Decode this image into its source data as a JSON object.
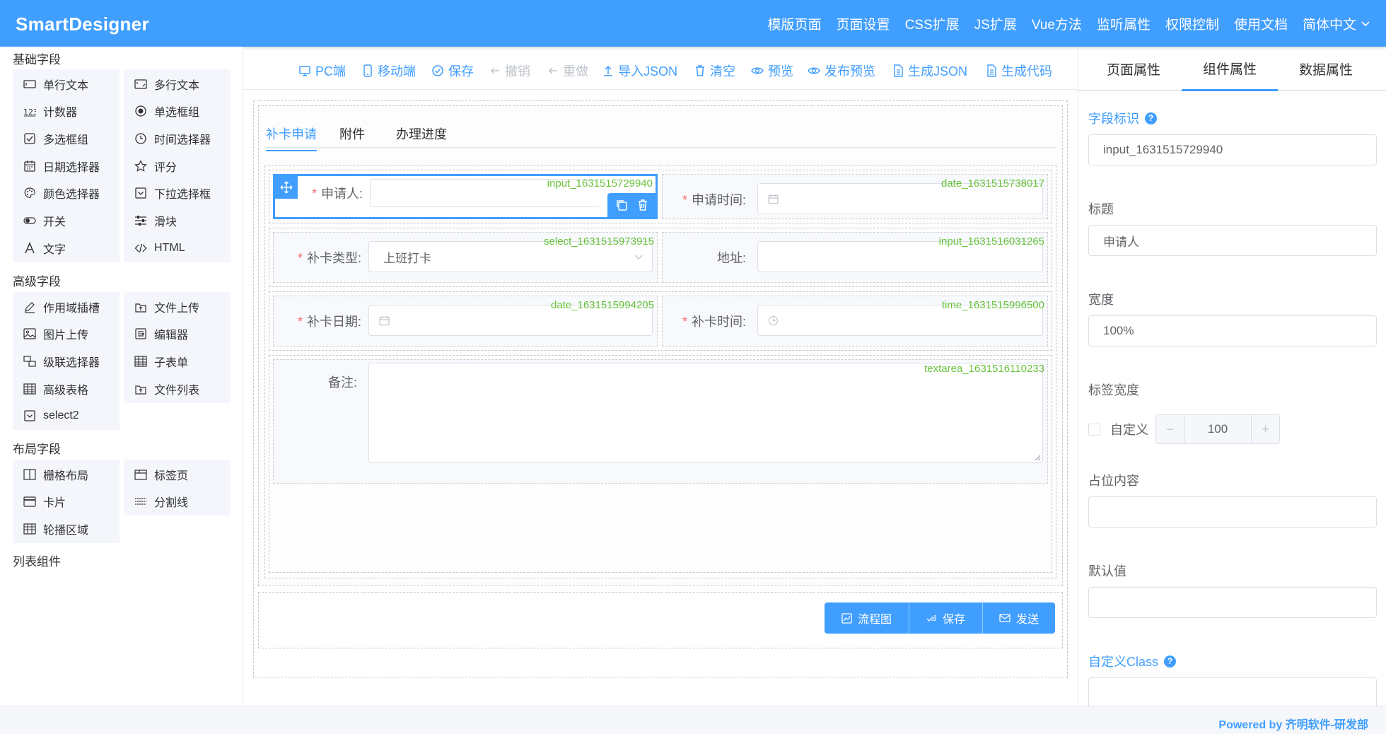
{
  "app": {
    "logo": "SmartDesigner"
  },
  "topnav": {
    "items": [
      "模版页面",
      "页面设置",
      "CSS扩展",
      "JS扩展",
      "Vue方法",
      "监听属性",
      "权限控制",
      "使用文档"
    ],
    "lang": "简体中文"
  },
  "left": {
    "groups": [
      {
        "title": "基础字段",
        "items": [
          {
            "label": "单行文本",
            "icon": "input-icon"
          },
          {
            "label": "多行文本",
            "icon": "textarea-icon"
          },
          {
            "label": "计数器",
            "icon": "number-icon"
          },
          {
            "label": "单选框组",
            "icon": "radio-icon"
          },
          {
            "label": "多选框组",
            "icon": "checkbox-icon"
          },
          {
            "label": "时间选择器",
            "icon": "clock-icon"
          },
          {
            "label": "日期选择器",
            "icon": "calendar-icon"
          },
          {
            "label": "评分",
            "icon": "star-icon"
          },
          {
            "label": "颜色选择器",
            "icon": "palette-icon"
          },
          {
            "label": "下拉选择框",
            "icon": "select-icon"
          },
          {
            "label": "开关",
            "icon": "switch-icon"
          },
          {
            "label": "滑块",
            "icon": "slider-icon"
          },
          {
            "label": "文字",
            "icon": "text-icon"
          },
          {
            "label": "HTML",
            "icon": "code-icon"
          }
        ]
      },
      {
        "title": "高级字段",
        "items": [
          {
            "label": "作用域插槽",
            "icon": "edit-icon"
          },
          {
            "label": "文件上传",
            "icon": "upload-icon"
          },
          {
            "label": "图片上传",
            "icon": "image-icon"
          },
          {
            "label": "编辑器",
            "icon": "editor-icon"
          },
          {
            "label": "级联选择器",
            "icon": "cascader-icon"
          },
          {
            "label": "子表单",
            "icon": "table-icon"
          },
          {
            "label": "高级表格",
            "icon": "table-icon"
          },
          {
            "label": "文件列表",
            "icon": "upload-icon"
          },
          {
            "label": "select2",
            "icon": "select-icon"
          }
        ]
      },
      {
        "title": "布局字段",
        "items": [
          {
            "label": "栅格布局",
            "icon": "grid-icon"
          },
          {
            "label": "标签页",
            "icon": "tabs-icon"
          },
          {
            "label": "卡片",
            "icon": "card-icon"
          },
          {
            "label": "分割线",
            "icon": "divider-icon"
          },
          {
            "label": "轮播区域",
            "icon": "carousel-icon"
          }
        ]
      },
      {
        "title": "列表组件",
        "items": []
      }
    ]
  },
  "toolbar": {
    "items": [
      {
        "label": "PC端",
        "icon": "monitor-icon",
        "disabled": false
      },
      {
        "label": "移动端",
        "icon": "mobile-icon",
        "disabled": false
      },
      {
        "label": "保存",
        "icon": "check-circle-icon",
        "disabled": false
      },
      {
        "label": "撤销",
        "icon": "undo-icon",
        "disabled": true
      },
      {
        "label": "重做",
        "icon": "redo-icon",
        "disabled": true
      },
      {
        "label": "导入JSON",
        "icon": "upload-arrow-icon",
        "disabled": false
      },
      {
        "label": "清空",
        "icon": "trash-icon",
        "disabled": false
      },
      {
        "label": "预览",
        "icon": "eye-icon",
        "disabled": false
      },
      {
        "label": "发布预览",
        "icon": "eye-icon",
        "disabled": false
      },
      {
        "label": "生成JSON",
        "icon": "document-icon",
        "disabled": false
      },
      {
        "label": "生成代码",
        "icon": "document-icon",
        "disabled": false
      }
    ]
  },
  "form": {
    "tabs": [
      "补卡申请",
      "附件",
      "办理进度"
    ],
    "active_tab": "补卡申请",
    "fields": {
      "applicant": {
        "label": "申请人:",
        "required": true,
        "id": "input_1631515729940",
        "value": ""
      },
      "apply_time": {
        "label": "申请时间:",
        "required": true,
        "id": "date_1631515738017",
        "value": ""
      },
      "card_type": {
        "label": "补卡类型:",
        "required": true,
        "id": "select_1631515973915",
        "value": "上班打卡"
      },
      "address": {
        "label": "地址:",
        "required": false,
        "id": "input_1631516031265",
        "value": ""
      },
      "card_date": {
        "label": "补卡日期:",
        "required": true,
        "id": "date_1631515994205",
        "value": ""
      },
      "card_time": {
        "label": "补卡时间:",
        "required": true,
        "id": "time_1631515996500",
        "value": ""
      },
      "remark": {
        "label": "备注:",
        "required": false,
        "id": "textarea_1631516110233",
        "value": ""
      }
    },
    "buttons": [
      {
        "label": "流程图",
        "icon": "flowchart-icon"
      },
      {
        "label": "保存",
        "icon": "save-icon"
      },
      {
        "label": "发送",
        "icon": "mail-icon"
      }
    ]
  },
  "right": {
    "tabs": [
      "页面属性",
      "组件属性",
      "数据属性"
    ],
    "active_tab": "组件属性",
    "props": {
      "field_id_label": "字段标识",
      "field_id_value": "input_1631515729940",
      "title_label": "标题",
      "title_value": "申请人",
      "width_label": "宽度",
      "width_value": "100%",
      "label_width_label": "标签宽度",
      "custom_label": "自定义",
      "label_width_value": "100",
      "placeholder_label": "占位内容",
      "placeholder_value": "",
      "default_label": "默认值",
      "default_value": "",
      "class_label": "自定义Class",
      "class_value": ""
    }
  },
  "footer": {
    "powered": "Powered by 齐明软件-研发部"
  },
  "colors": {
    "primary": "#409eff",
    "id_text": "#67c23a",
    "required": "#f56c6c"
  }
}
